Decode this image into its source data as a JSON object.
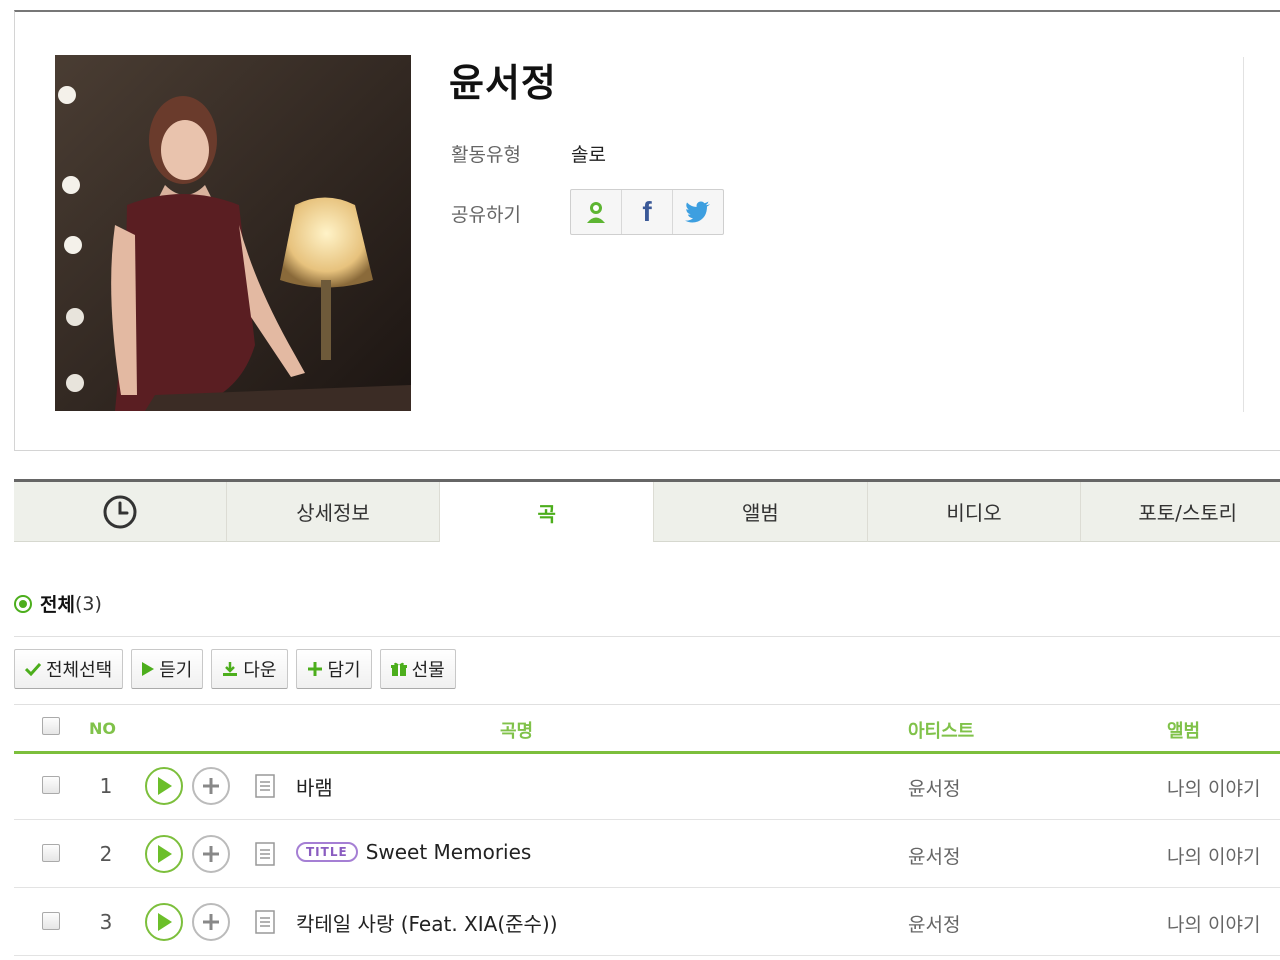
{
  "artist": {
    "name": "윤서정",
    "activity_label": "활동유형",
    "activity_value": "솔로",
    "share_label": "공유하기",
    "share_buttons": [
      "melon-friend-icon",
      "facebook-icon",
      "twitter-icon"
    ],
    "share_facebook_text": "f"
  },
  "tabs": [
    {
      "label": "",
      "icon": "clock-icon"
    },
    {
      "label": "상세정보"
    },
    {
      "label": "곡",
      "active": true
    },
    {
      "label": "앨범"
    },
    {
      "label": "비디오"
    },
    {
      "label": "포토/스토리"
    }
  ],
  "filter": {
    "label": "전체",
    "count": "(3)"
  },
  "toolbar": {
    "select_all": "전체선택",
    "listen": "듣기",
    "download": "다운",
    "add": "담기",
    "gift": "선물"
  },
  "table": {
    "headers": {
      "no": "NO",
      "song": "곡명",
      "artist": "아티스트",
      "album": "앨범"
    },
    "rows": [
      {
        "no": "1",
        "title": "바램",
        "badge": "",
        "artist": "윤서정",
        "album": "나의 이야기"
      },
      {
        "no": "2",
        "title": "Sweet Memories",
        "badge": "TITLE",
        "artist": "윤서정",
        "album": "나의 이야기"
      },
      {
        "no": "3",
        "title": "칵테일 사랑 (Feat. XIA(준수))",
        "badge": "",
        "artist": "윤서정",
        "album": "나의 이야기"
      }
    ]
  },
  "colors": {
    "accent": "#4cae1c",
    "header_green": "#80c24a",
    "badge_purple": "#a57fd4"
  }
}
